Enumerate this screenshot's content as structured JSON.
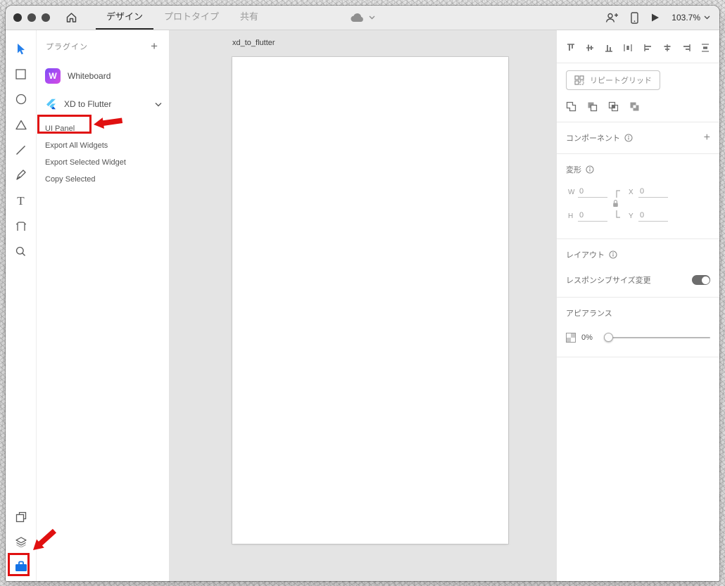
{
  "window": {
    "tabs": [
      {
        "label": "デザイン",
        "active": true
      },
      {
        "label": "プロトタイプ",
        "active": false
      },
      {
        "label": "共有",
        "active": false
      }
    ],
    "zoom_level": "103.7%"
  },
  "colors": {
    "accent_blue": "#1473e6",
    "select_tool_blue": "#2680eb",
    "annotation_red": "#e01010",
    "canvas_gray": "#e4e4e4"
  },
  "icons": {
    "add_plus": "+",
    "whiteboard_letter": "W",
    "text_tool_letter": "T"
  },
  "plugins_panel": {
    "title": "プラグイン",
    "plugins": [
      {
        "name": "Whiteboard"
      },
      {
        "name": "XD to Flutter"
      }
    ],
    "menu_items": [
      "UI Panel",
      "Export All Widgets",
      "Export Selected Widget",
      "Copy Selected"
    ]
  },
  "canvas": {
    "artboard_name": "xd_to_flutter"
  },
  "inspector": {
    "repeat_grid_label": "リピートグリッド",
    "component_label": "コンポーネント",
    "transform_label": "変形",
    "fields": {
      "w_label": "W",
      "h_label": "H",
      "x_label": "X",
      "y_label": "Y",
      "w": "0",
      "h": "0",
      "x": "0",
      "y": "0"
    },
    "layout_label": "レイアウト",
    "responsive_label": "レスポンシブサイズ変更",
    "appearance_label": "アピアランス",
    "opacity_value": "0%"
  }
}
